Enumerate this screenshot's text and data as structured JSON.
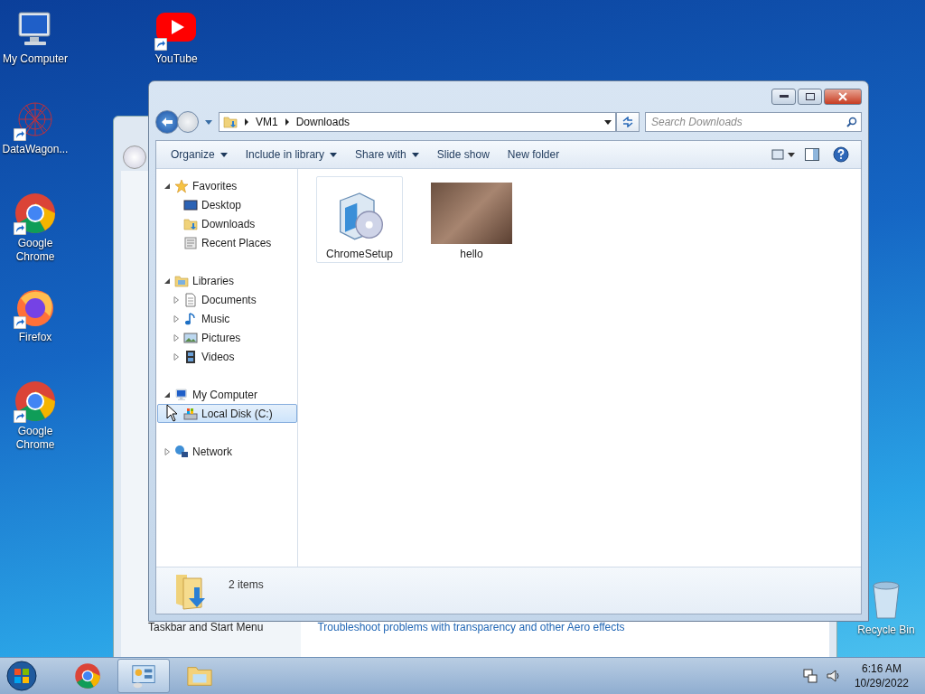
{
  "desktop_icons": [
    {
      "label": "My Computer",
      "kind": "computer",
      "shortcut": false
    },
    {
      "label": "YouTube",
      "kind": "youtube",
      "shortcut": true
    },
    {
      "label": "DataWagon...",
      "kind": "network-art",
      "shortcut": true
    },
    {
      "label": "Google Chrome",
      "kind": "chrome",
      "shortcut": true
    },
    {
      "label": "Firefox",
      "kind": "firefox",
      "shortcut": true
    },
    {
      "label": "Google Chrome",
      "kind": "chrome",
      "shortcut": true
    },
    {
      "label": "Recycle Bin",
      "kind": "recycle",
      "shortcut": false
    }
  ],
  "background_window": {
    "heading": "Taskbar and Start Menu",
    "link": "Troubleshoot problems with transparency and other Aero effects"
  },
  "explorer": {
    "address": [
      "VM1",
      "Downloads"
    ],
    "search": {
      "placeholder": "Search Downloads"
    },
    "toolbar": [
      {
        "label": "Organize",
        "dropdown": true
      },
      {
        "label": "Include in library",
        "dropdown": true
      },
      {
        "label": "Share with",
        "dropdown": true
      },
      {
        "label": "Slide show",
        "dropdown": false
      },
      {
        "label": "New folder",
        "dropdown": false
      }
    ],
    "nav": [
      {
        "label": "Favorites",
        "kind": "star",
        "expanded": true,
        "selected": false,
        "children": [
          {
            "label": "Desktop",
            "kind": "desktop",
            "selected": false
          },
          {
            "label": "Downloads",
            "kind": "downloads",
            "selected": false
          },
          {
            "label": "Recent Places",
            "kind": "recent",
            "selected": false
          }
        ]
      },
      {
        "label": "Libraries",
        "kind": "library",
        "expanded": true,
        "selected": false,
        "children": [
          {
            "label": "Documents",
            "kind": "document",
            "expanded": false,
            "selected": false
          },
          {
            "label": "Music",
            "kind": "music",
            "expanded": false,
            "selected": false
          },
          {
            "label": "Pictures",
            "kind": "pictures",
            "expanded": false,
            "selected": false
          },
          {
            "label": "Videos",
            "kind": "videos",
            "expanded": false,
            "selected": false
          }
        ]
      },
      {
        "label": "My Computer",
        "kind": "computer",
        "expanded": true,
        "selected": false,
        "children": [
          {
            "label": "Local Disk (C:)",
            "kind": "disk",
            "selected": true
          }
        ]
      },
      {
        "label": "Network",
        "kind": "network",
        "expanded": false,
        "selected": false
      }
    ],
    "files": [
      {
        "name": "ChromeSetup",
        "kind": "installer",
        "highlighted": true
      },
      {
        "name": "hello",
        "kind": "video",
        "highlighted": false
      }
    ],
    "status": "2 items"
  },
  "taskbar": {
    "apps": [
      {
        "kind": "chrome",
        "active": false
      },
      {
        "kind": "control-panel",
        "active": true
      },
      {
        "kind": "explorer",
        "active": false
      }
    ],
    "time": "6:16 AM",
    "date": "10/29/2022"
  }
}
